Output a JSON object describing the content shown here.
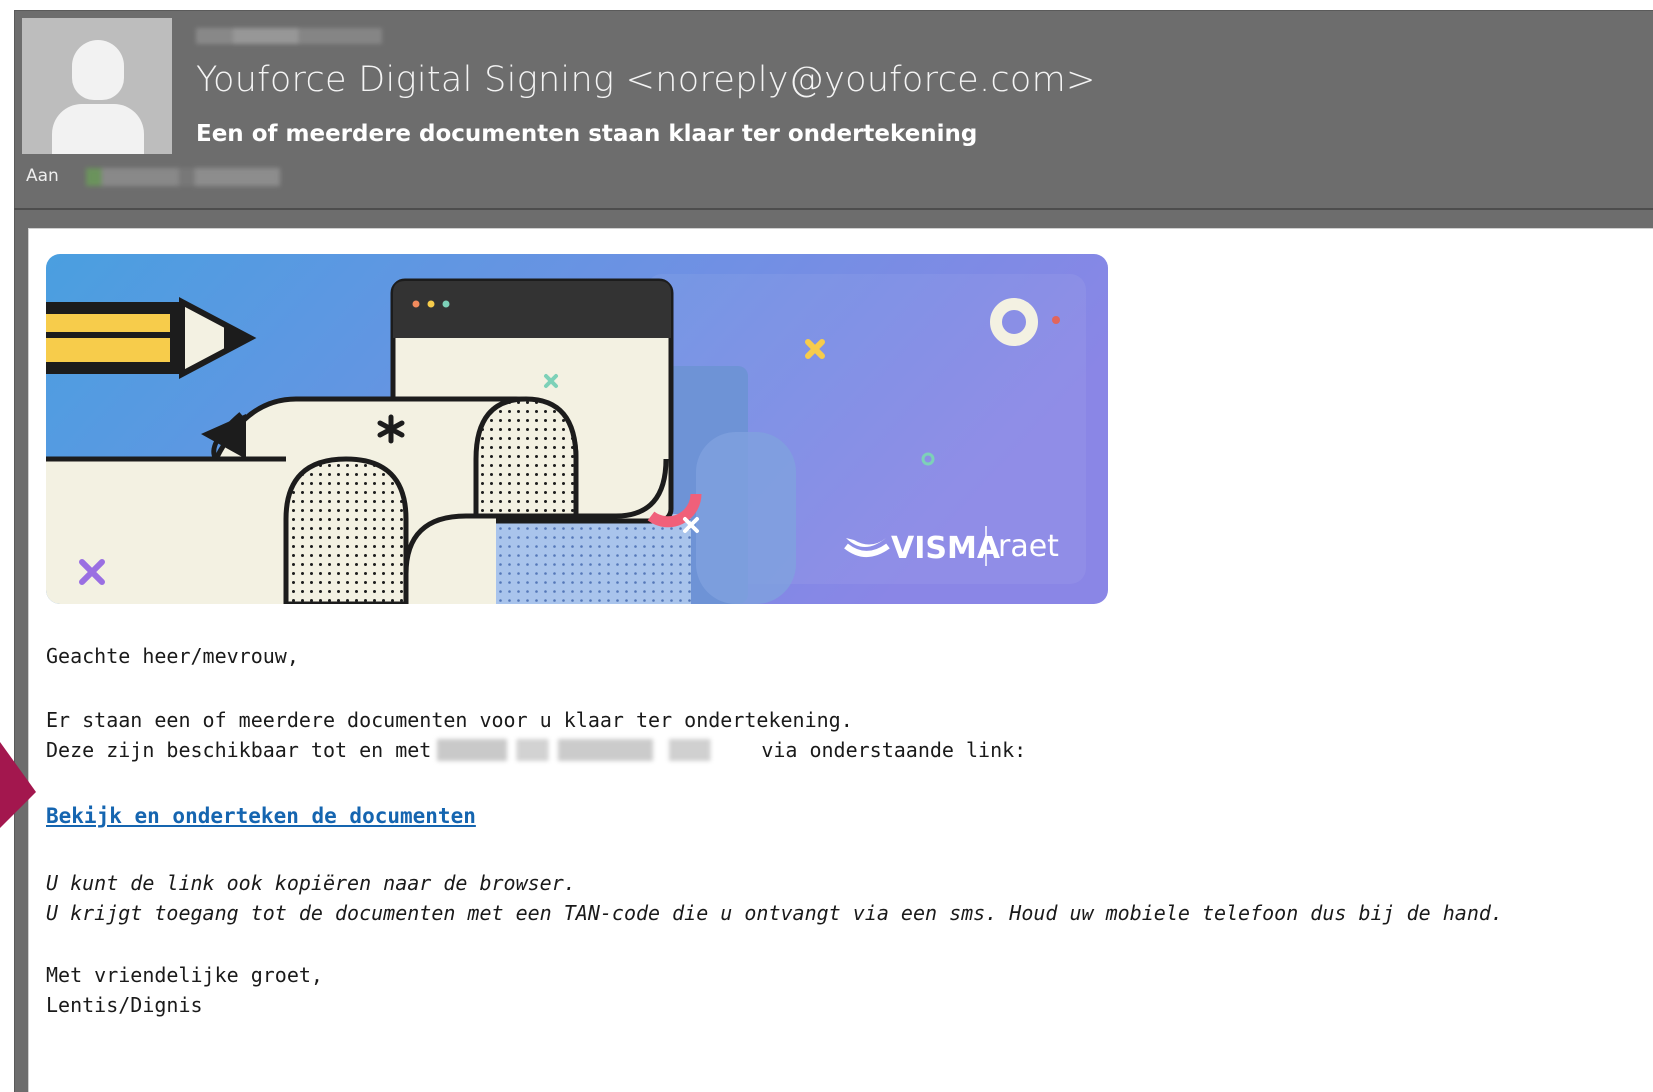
{
  "header": {
    "sender_display": "Youforce Digital Signing <noreply@youforce.com>",
    "subject": "Een of meerdere documenten staan klaar ter ondertekening",
    "to_label": "Aan"
  },
  "banner": {
    "brand_logo_text": "VISMA",
    "brand_sub_text": "raet",
    "colors": {
      "gradient_start": "#4a9fe0",
      "gradient_end": "#8a86e6",
      "paper": "#f3f1e2",
      "ink": "#1c1c1c"
    }
  },
  "body": {
    "greeting": "Geachte heer/mevrouw,",
    "line1": "Er staan een of meerdere documenten voor u klaar ter ondertekening.",
    "line2_prefix": "Deze zijn beschikbaar tot en met",
    "line2_suffix": "via onderstaande link:",
    "cta_link": "Bekijk en onderteken de documenten",
    "note1": "U kunt de link ook kopiëren naar de browser.",
    "note2": "U krijgt toegang tot de documenten met een TAN-code die u ontvangt via een sms. Houd uw mobiele telefoon dus bij de hand.",
    "closing": "Met vriendelijke groet,",
    "signature": "Lentis/Dignis"
  },
  "colors": {
    "header_bg": "#6d6d6d",
    "link": "#1565b0",
    "accent_arrow": "#a3174e"
  },
  "icons": [
    "user-avatar-icon",
    "visma-swoosh-icon"
  ]
}
